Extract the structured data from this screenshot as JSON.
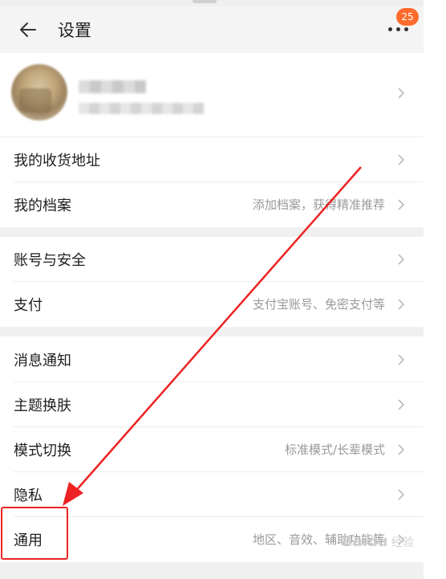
{
  "header": {
    "title": "设置",
    "badge_count": "25",
    "back_icon": "arrow-left-icon",
    "more_icon": "more-horizontal-icon"
  },
  "groups": [
    {
      "items": [
        {
          "key": "address",
          "label": "我的收货地址",
          "hint": ""
        },
        {
          "key": "profile-file",
          "label": "我的档案",
          "hint": "添加档案，获得精准推荐"
        }
      ]
    },
    {
      "items": [
        {
          "key": "account-security",
          "label": "账号与安全",
          "hint": ""
        },
        {
          "key": "payment",
          "label": "支付",
          "hint": "支付宝账号、免密支付等"
        }
      ]
    },
    {
      "items": [
        {
          "key": "notifications",
          "label": "消息通知",
          "hint": ""
        },
        {
          "key": "theme",
          "label": "主题换肤",
          "hint": ""
        },
        {
          "key": "mode-switch",
          "label": "模式切换",
          "hint": "标准模式/长辈模式"
        },
        {
          "key": "privacy",
          "label": "隐私",
          "hint": ""
        },
        {
          "key": "general",
          "label": "通用",
          "hint": "地区、音效、辅助功能等"
        }
      ]
    }
  ],
  "watermark": {
    "text": "Baidu",
    "sub": "经验"
  },
  "colors": {
    "accent": "#ff6b2c",
    "annotation": "#e22222",
    "hint": "#999999"
  }
}
